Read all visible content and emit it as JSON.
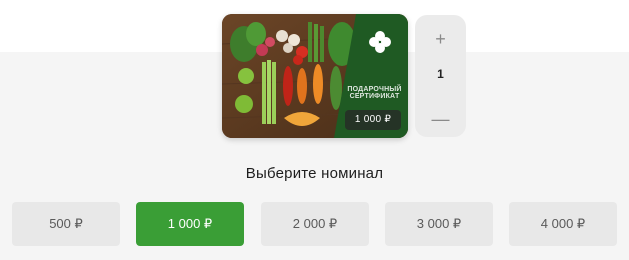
{
  "card": {
    "label": "ПОДАРОЧНЫЙ СЕРТИФИКАТ",
    "price": "1 000 ₽",
    "brand_color": "#1f5a23",
    "icon": "clover-logo-icon"
  },
  "stepper": {
    "plus": "+",
    "minus": "—",
    "value": "1"
  },
  "title": "Выберите номинал",
  "denominations": [
    {
      "label": "500 ₽",
      "selected": false
    },
    {
      "label": "1 000 ₽",
      "selected": true
    },
    {
      "label": "2 000 ₽",
      "selected": false
    },
    {
      "label": "3 000 ₽",
      "selected": false
    },
    {
      "label": "4 000 ₽",
      "selected": false
    }
  ],
  "colors": {
    "accent": "#3a9e36",
    "button_bg": "#e8e8e8",
    "page_band": "#f5f5f5"
  }
}
